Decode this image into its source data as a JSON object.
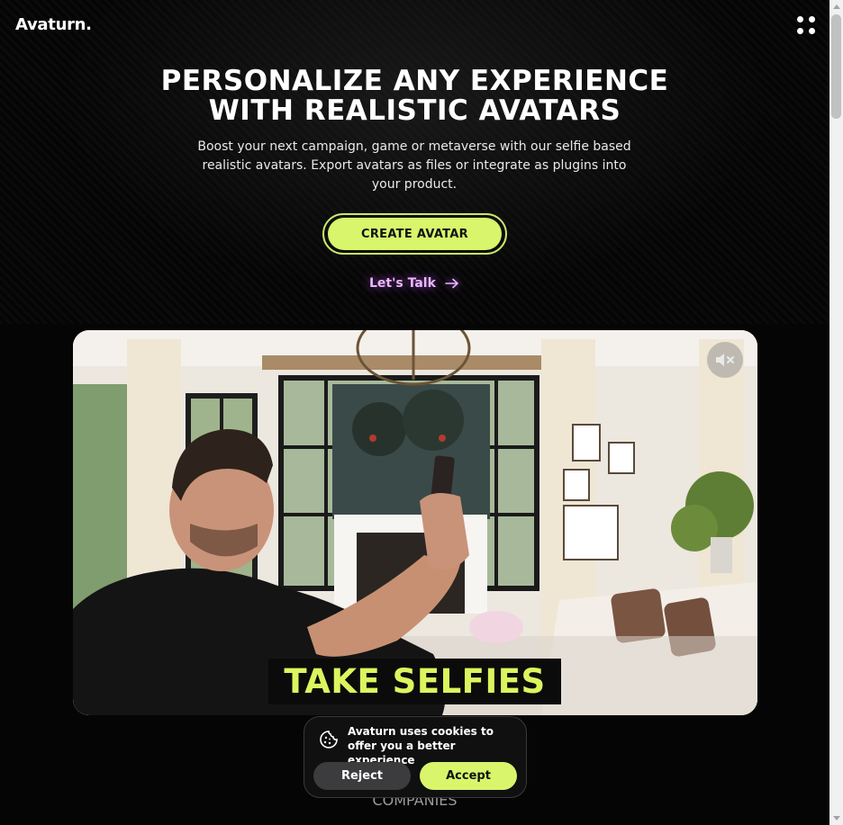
{
  "header": {
    "logo": "Avaturn.",
    "menu_icon": "menu-dots-icon"
  },
  "hero": {
    "headline_line1": "PERSONALIZE ANY EXPERIENCE",
    "headline_line2": "WITH REALISTIC AVATARS",
    "subtext": "Boost your next campaign, game or metaverse with our selfie based realistic avatars. Export avatars as files or integrate as plugins into your product.",
    "cta_label": "CREATE AVATAR",
    "talk_label": "Let's Talk",
    "talk_icon": "arrow-right-icon"
  },
  "video": {
    "caption": "TAKE SELFIES",
    "mute_icon": "speaker-muted-icon"
  },
  "companies_label": "COMPANIES",
  "cookie_banner": {
    "icon": "cookie-icon",
    "message": "Avaturn uses cookies to offer you a better experience",
    "reject_label": "Reject",
    "accept_label": "Accept"
  },
  "colors": {
    "accent": "#d8f56c",
    "link": "#e9b7ff",
    "background": "#050505"
  }
}
